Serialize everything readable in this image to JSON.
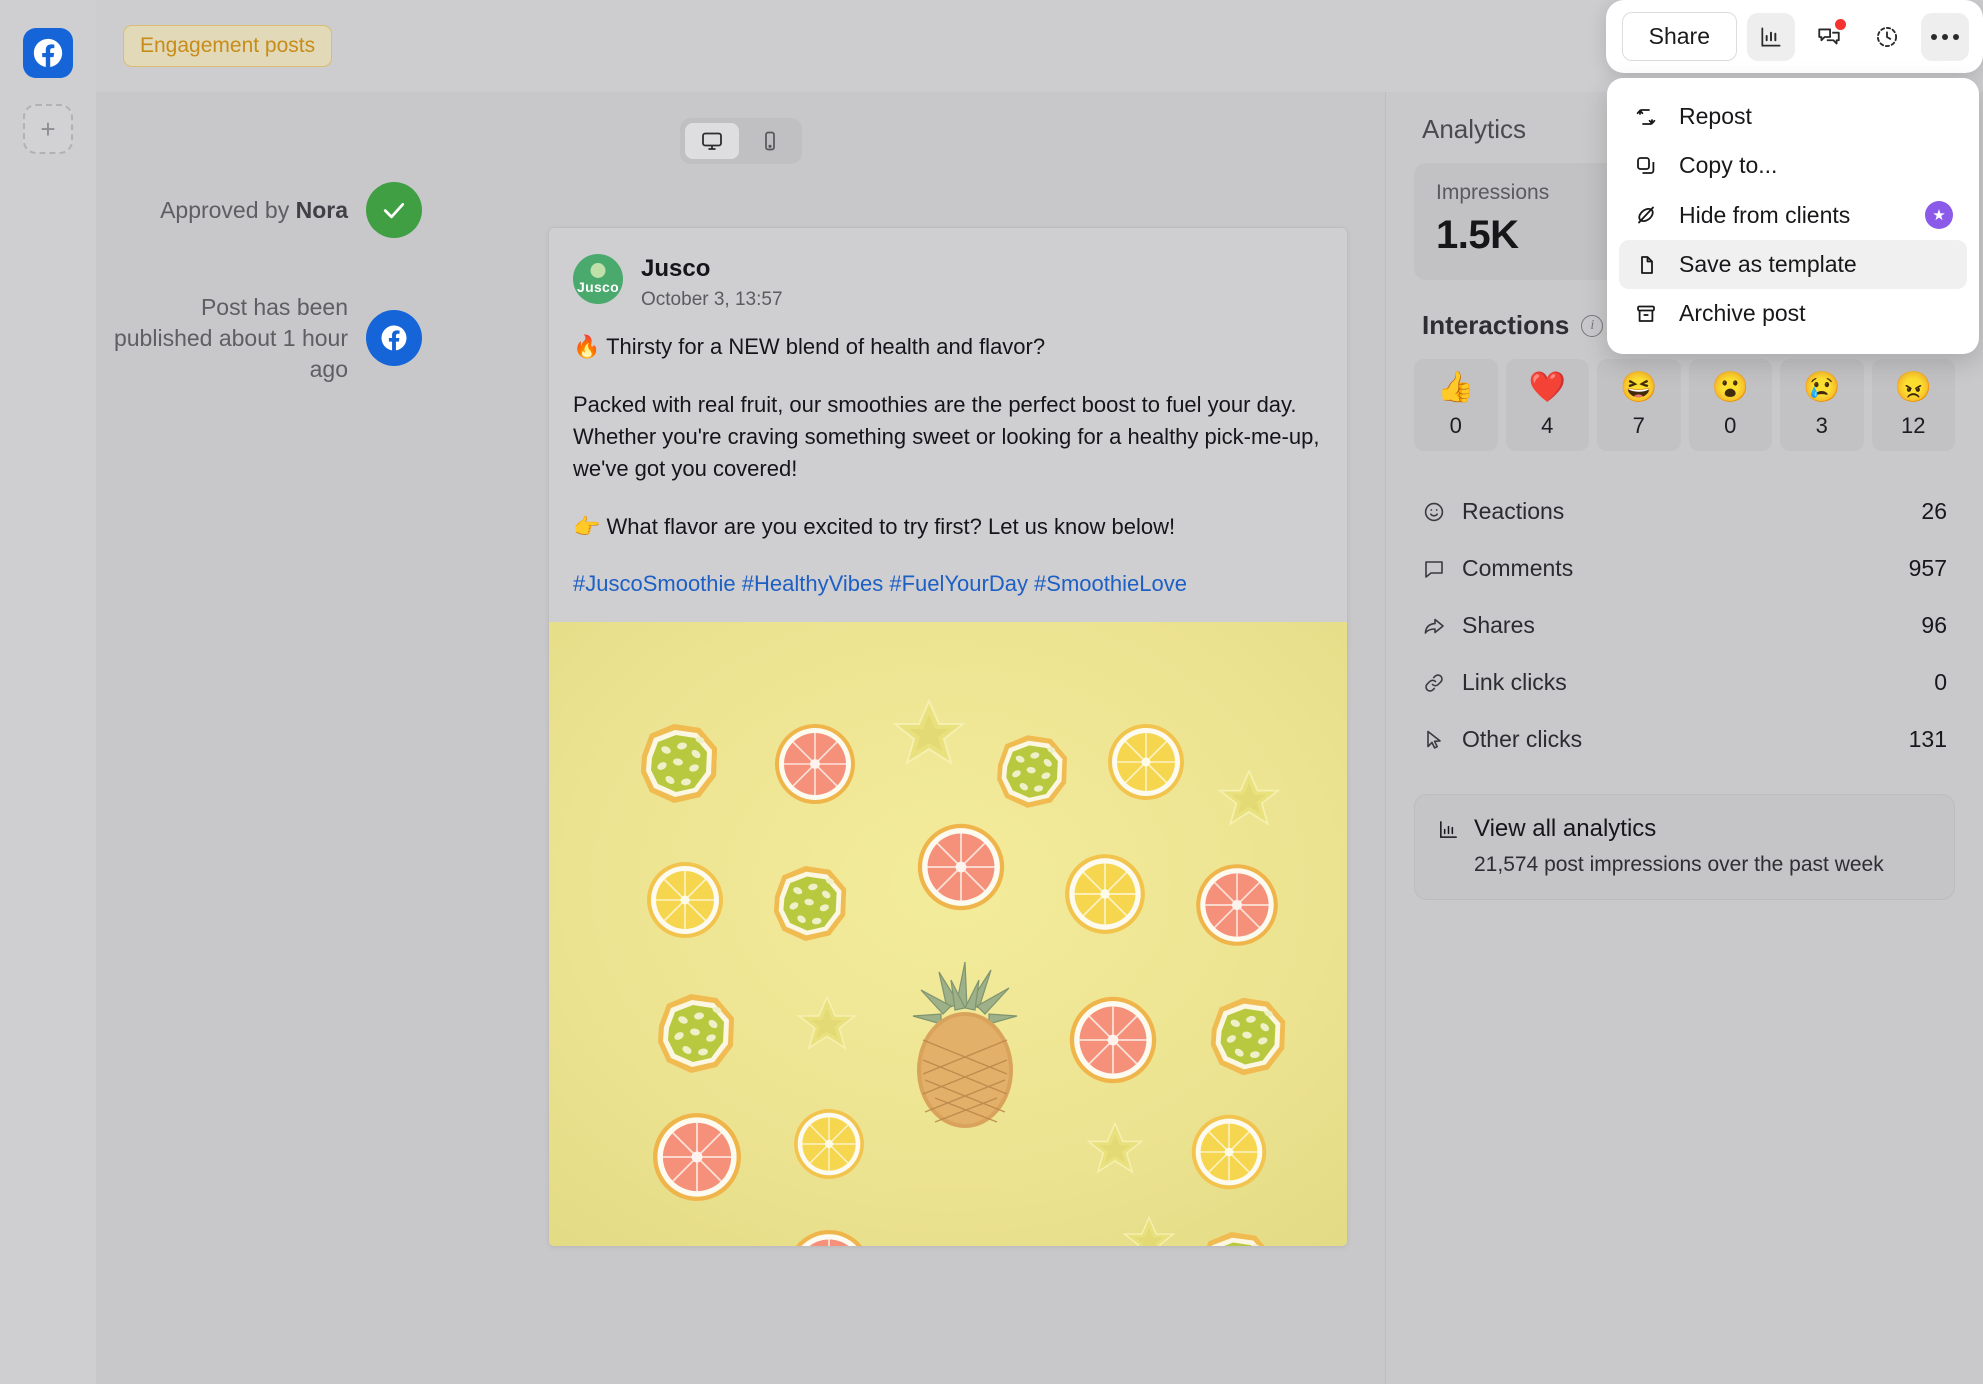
{
  "rail": {
    "facebook_icon": "facebook-icon",
    "add_label": "+"
  },
  "topbar": {
    "tag_label": "Engagement posts",
    "share_label": "Share",
    "icons": [
      "analytics-bar-chart-icon",
      "comments-icon",
      "history-clock-icon",
      "more-options-icon"
    ]
  },
  "menu": {
    "items": [
      {
        "label": "Repost",
        "icon": "repost-icon",
        "badge": "",
        "active": false
      },
      {
        "label": "Copy to...",
        "icon": "copy-icon",
        "badge": "",
        "active": false
      },
      {
        "label": "Hide from clients",
        "icon": "eye-off-icon",
        "badge": "★",
        "active": false
      },
      {
        "label": "Save as template",
        "icon": "file-icon",
        "badge": "",
        "active": true
      },
      {
        "label": "Archive post",
        "icon": "archive-icon",
        "badge": "",
        "active": false
      }
    ]
  },
  "canvas": {
    "device_desktop": "desktop-icon",
    "device_mobile": "mobile-icon",
    "approval": {
      "approved_prefix": "Approved by ",
      "approved_name": "Nora",
      "published_text": "Post has been published about 1 hour ago"
    }
  },
  "post": {
    "brand": "Jusco",
    "brand_mark": "Jusco",
    "date": "October 3, 13:57",
    "line1": "🔥 Thirsty for a NEW blend of health and flavor?",
    "line2": "Packed with real fruit, our smoothies are the perfect boost to fuel your day. Whether you're craving something sweet or looking for a healthy pick-me-up, we've got you covered!",
    "line3": "👉 What flavor are you excited to try first? Let us know below!",
    "hashtags": "#JuscoSmoothie #HealthyVibes #FuelYourDay #SmoothieLove",
    "image_alt": "citrus-slices-and-pineapple-flatlay"
  },
  "analytics": {
    "title": "Analytics",
    "impressions_label": "Impressions",
    "impressions_value": "1.5K",
    "interactions_label": "Interactions",
    "reactions": [
      {
        "emoji": "👍",
        "name": "like-reaction",
        "count": "0"
      },
      {
        "emoji": "❤️",
        "name": "love-reaction",
        "count": "4"
      },
      {
        "emoji": "😆",
        "name": "haha-reaction",
        "count": "7"
      },
      {
        "emoji": "😮",
        "name": "wow-reaction",
        "count": "0"
      },
      {
        "emoji": "😢",
        "name": "sad-reaction",
        "count": "3"
      },
      {
        "emoji": "😠",
        "name": "angry-reaction",
        "count": "12"
      }
    ],
    "metrics": [
      {
        "label": "Reactions",
        "value": "26",
        "icon": "smiley-icon"
      },
      {
        "label": "Comments",
        "value": "957",
        "icon": "comment-icon"
      },
      {
        "label": "Shares",
        "value": "96",
        "icon": "share-arrow-icon"
      },
      {
        "label": "Link clicks",
        "value": "0",
        "icon": "link-icon"
      },
      {
        "label": "Other clicks",
        "value": "131",
        "icon": "cursor-icon"
      }
    ],
    "view_all_label": "View all analytics",
    "view_all_sub": "21,574 post impressions over the past week"
  },
  "colors": {
    "brand_blue": "#1565d8",
    "approve_green": "#3f9f42",
    "tag_amber": "#c78d18",
    "premium_purple": "#8c5ae8",
    "link_blue": "#1d5fc4",
    "notify_red": "#f4332f"
  }
}
